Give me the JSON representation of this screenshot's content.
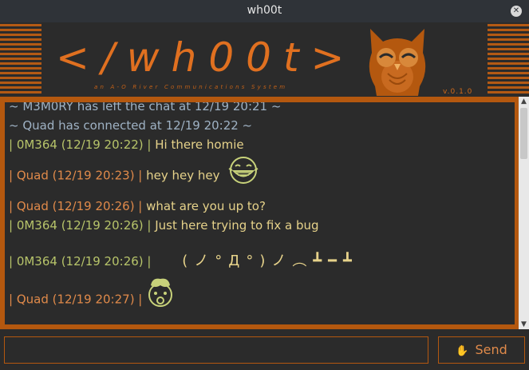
{
  "window": {
    "title": "wh00t"
  },
  "banner": {
    "logo": "</wh00t>",
    "tagline": "an A-O River Communications System",
    "version": "v.0.1.0"
  },
  "messages": [
    {
      "kind": "system",
      "text": "~ M3M0RY has left the chat at 12/19 20:21 ~"
    },
    {
      "kind": "system",
      "text": "~ Quad has connected at 12/19 20:22 ~"
    },
    {
      "kind": "user",
      "user_class": "u0m",
      "prefix": "| 0M364 (12/19 20:22) | ",
      "text": "Hi there homie"
    },
    {
      "kind": "user",
      "user_class": "uquad",
      "prefix": "| Quad (12/19 20:23) | ",
      "text": "hey hey hey",
      "emoji": "laughing-face-icon"
    },
    {
      "kind": "user",
      "user_class": "uquad",
      "prefix": "| Quad (12/19 20:26) | ",
      "text": "what are you up to?"
    },
    {
      "kind": "user",
      "user_class": "u0m",
      "prefix": "| 0M364 (12/19 20:26) | ",
      "text": "Just here trying to fix a bug"
    },
    {
      "kind": "user",
      "user_class": "u0m",
      "prefix": "| 0M364 (12/19 20:26) | ",
      "text": "(ノ°Д°)ノ︵┻━┻"
    },
    {
      "kind": "user",
      "user_class": "uquad",
      "prefix": "| Quad (12/19 20:27) | ",
      "text": "",
      "emoji": "exploding-head-icon"
    }
  ],
  "input": {
    "value": "",
    "placeholder": ""
  },
  "send": {
    "label": "Send",
    "icon": "hand-icon"
  },
  "colors": {
    "accent": "#b4580f",
    "background": "#2b2b2b",
    "text": "#e6d28a"
  }
}
